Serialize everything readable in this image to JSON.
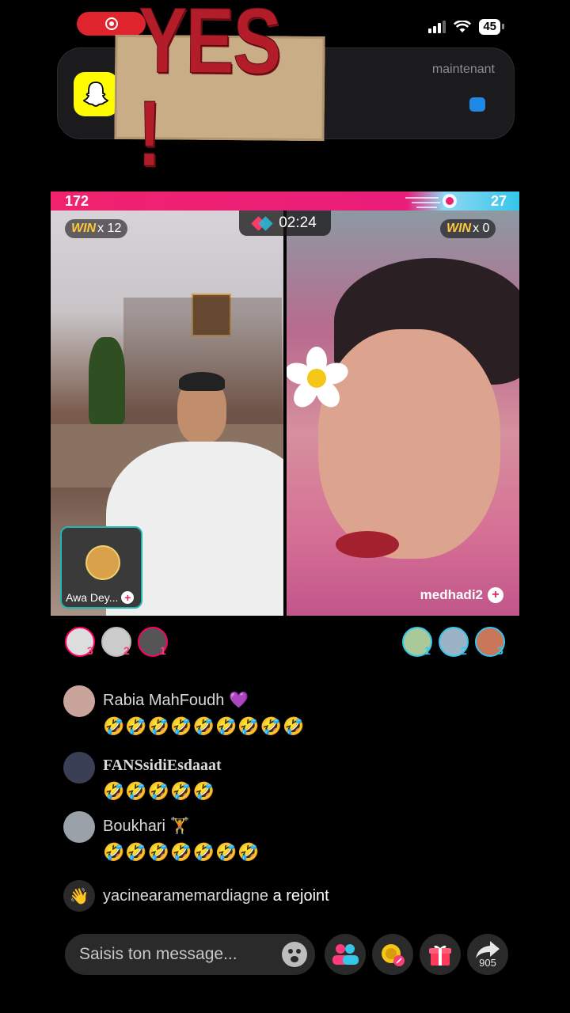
{
  "status_bar": {
    "battery": "45"
  },
  "notification": {
    "time": "maintenant"
  },
  "sticker": {
    "text": "YES !"
  },
  "battle": {
    "score_left": "172",
    "score_right": "27",
    "timer": "02:24",
    "left_win_label": "WIN",
    "left_win_count": "x 12",
    "right_win_label": "WIN",
    "right_win_count": "x 0",
    "guest_name": "Awa Dey...",
    "right_host_name": "medhadi2"
  },
  "supporters": {
    "left": [
      "3",
      "2",
      "1"
    ],
    "right": [
      "1",
      "2",
      "3"
    ]
  },
  "chat": [
    {
      "user": "Rabia MahFoudh",
      "badge": "💜",
      "message": "🤣🤣🤣🤣🤣🤣🤣🤣🤣"
    },
    {
      "user": "FANSsidiEsdaaat",
      "badge": "",
      "message": "🤣🤣🤣🤣🤣"
    },
    {
      "user": "Boukhari",
      "badge": "🏋️",
      "message": "🤣🤣🤣🤣🤣🤣🤣"
    }
  ],
  "join_event": {
    "user": "yacinearamemardiagne",
    "text": "a rejoint"
  },
  "bottom": {
    "input_placeholder": "Saisis ton message...",
    "share_count": "905"
  },
  "colors": {
    "accent_pink": "#f0226e",
    "accent_cyan": "#35c6ea",
    "win_gold": "#ffc83a"
  }
}
